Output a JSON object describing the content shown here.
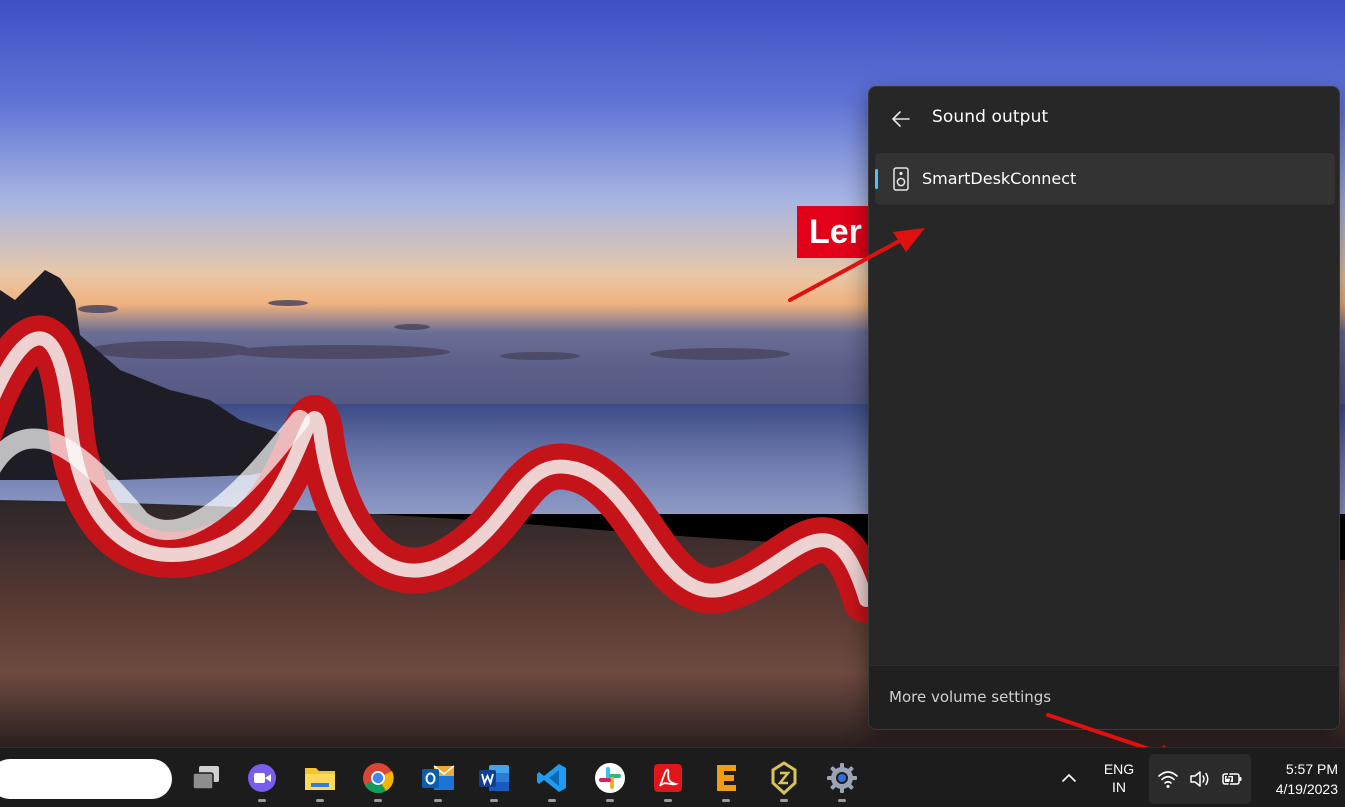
{
  "wallpaper": {
    "logo_text": "Ler"
  },
  "flyout": {
    "title": "Sound output",
    "devices": [
      {
        "label": "SmartDeskConnect",
        "selected": true,
        "icon": "speaker-icon"
      }
    ],
    "footer_link": "More volume settings",
    "accent_color": "#4cc2ff"
  },
  "annotations": {
    "arrow_color": "#e01010"
  },
  "taskbar": {
    "apps": [
      {
        "name": "task-view",
        "icon": "task-view-icon"
      },
      {
        "name": "meet",
        "icon": "video-camera-icon"
      },
      {
        "name": "file-explorer",
        "icon": "folder-icon"
      },
      {
        "name": "chrome",
        "icon": "chrome-icon"
      },
      {
        "name": "outlook",
        "icon": "outlook-icon"
      },
      {
        "name": "word",
        "icon": "word-icon"
      },
      {
        "name": "vscode",
        "icon": "vscode-icon"
      },
      {
        "name": "slack",
        "icon": "slack-icon"
      },
      {
        "name": "acrobat",
        "icon": "acrobat-icon"
      },
      {
        "name": "e-app",
        "icon": "e-letter-icon"
      },
      {
        "name": "pin-app",
        "icon": "pin-icon"
      },
      {
        "name": "settings",
        "icon": "gear-icon"
      }
    ],
    "language": {
      "line1": "ENG",
      "line2": "IN"
    },
    "clock": {
      "time": "5:57 PM",
      "date": "4/19/2023"
    }
  }
}
